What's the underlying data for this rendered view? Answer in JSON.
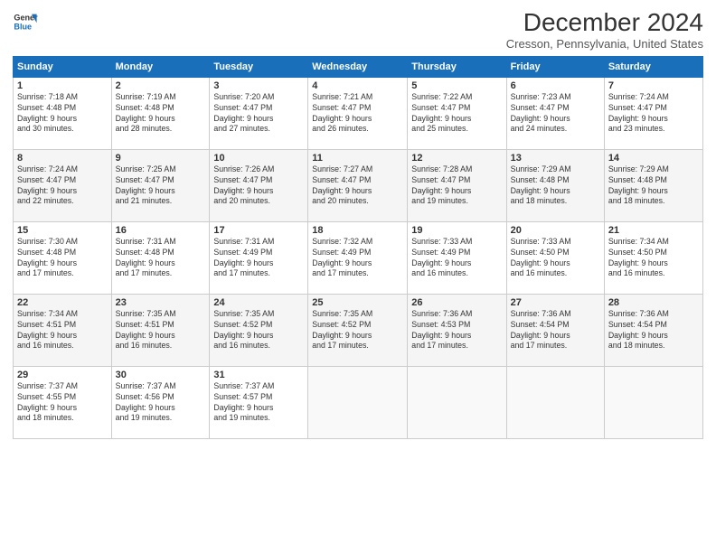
{
  "header": {
    "logo_line1": "General",
    "logo_line2": "Blue",
    "month_title": "December 2024",
    "location": "Cresson, Pennsylvania, United States"
  },
  "columns": [
    "Sunday",
    "Monday",
    "Tuesday",
    "Wednesday",
    "Thursday",
    "Friday",
    "Saturday"
  ],
  "weeks": [
    [
      {
        "day": "1",
        "info": "Sunrise: 7:18 AM\nSunset: 4:48 PM\nDaylight: 9 hours\nand 30 minutes."
      },
      {
        "day": "2",
        "info": "Sunrise: 7:19 AM\nSunset: 4:48 PM\nDaylight: 9 hours\nand 28 minutes."
      },
      {
        "day": "3",
        "info": "Sunrise: 7:20 AM\nSunset: 4:47 PM\nDaylight: 9 hours\nand 27 minutes."
      },
      {
        "day": "4",
        "info": "Sunrise: 7:21 AM\nSunset: 4:47 PM\nDaylight: 9 hours\nand 26 minutes."
      },
      {
        "day": "5",
        "info": "Sunrise: 7:22 AM\nSunset: 4:47 PM\nDaylight: 9 hours\nand 25 minutes."
      },
      {
        "day": "6",
        "info": "Sunrise: 7:23 AM\nSunset: 4:47 PM\nDaylight: 9 hours\nand 24 minutes."
      },
      {
        "day": "7",
        "info": "Sunrise: 7:24 AM\nSunset: 4:47 PM\nDaylight: 9 hours\nand 23 minutes."
      }
    ],
    [
      {
        "day": "8",
        "info": "Sunrise: 7:24 AM\nSunset: 4:47 PM\nDaylight: 9 hours\nand 22 minutes."
      },
      {
        "day": "9",
        "info": "Sunrise: 7:25 AM\nSunset: 4:47 PM\nDaylight: 9 hours\nand 21 minutes."
      },
      {
        "day": "10",
        "info": "Sunrise: 7:26 AM\nSunset: 4:47 PM\nDaylight: 9 hours\nand 20 minutes."
      },
      {
        "day": "11",
        "info": "Sunrise: 7:27 AM\nSunset: 4:47 PM\nDaylight: 9 hours\nand 20 minutes."
      },
      {
        "day": "12",
        "info": "Sunrise: 7:28 AM\nSunset: 4:47 PM\nDaylight: 9 hours\nand 19 minutes."
      },
      {
        "day": "13",
        "info": "Sunrise: 7:29 AM\nSunset: 4:48 PM\nDaylight: 9 hours\nand 18 minutes."
      },
      {
        "day": "14",
        "info": "Sunrise: 7:29 AM\nSunset: 4:48 PM\nDaylight: 9 hours\nand 18 minutes."
      }
    ],
    [
      {
        "day": "15",
        "info": "Sunrise: 7:30 AM\nSunset: 4:48 PM\nDaylight: 9 hours\nand 17 minutes."
      },
      {
        "day": "16",
        "info": "Sunrise: 7:31 AM\nSunset: 4:48 PM\nDaylight: 9 hours\nand 17 minutes."
      },
      {
        "day": "17",
        "info": "Sunrise: 7:31 AM\nSunset: 4:49 PM\nDaylight: 9 hours\nand 17 minutes."
      },
      {
        "day": "18",
        "info": "Sunrise: 7:32 AM\nSunset: 4:49 PM\nDaylight: 9 hours\nand 17 minutes."
      },
      {
        "day": "19",
        "info": "Sunrise: 7:33 AM\nSunset: 4:49 PM\nDaylight: 9 hours\nand 16 minutes."
      },
      {
        "day": "20",
        "info": "Sunrise: 7:33 AM\nSunset: 4:50 PM\nDaylight: 9 hours\nand 16 minutes."
      },
      {
        "day": "21",
        "info": "Sunrise: 7:34 AM\nSunset: 4:50 PM\nDaylight: 9 hours\nand 16 minutes."
      }
    ],
    [
      {
        "day": "22",
        "info": "Sunrise: 7:34 AM\nSunset: 4:51 PM\nDaylight: 9 hours\nand 16 minutes."
      },
      {
        "day": "23",
        "info": "Sunrise: 7:35 AM\nSunset: 4:51 PM\nDaylight: 9 hours\nand 16 minutes."
      },
      {
        "day": "24",
        "info": "Sunrise: 7:35 AM\nSunset: 4:52 PM\nDaylight: 9 hours\nand 16 minutes."
      },
      {
        "day": "25",
        "info": "Sunrise: 7:35 AM\nSunset: 4:52 PM\nDaylight: 9 hours\nand 17 minutes."
      },
      {
        "day": "26",
        "info": "Sunrise: 7:36 AM\nSunset: 4:53 PM\nDaylight: 9 hours\nand 17 minutes."
      },
      {
        "day": "27",
        "info": "Sunrise: 7:36 AM\nSunset: 4:54 PM\nDaylight: 9 hours\nand 17 minutes."
      },
      {
        "day": "28",
        "info": "Sunrise: 7:36 AM\nSunset: 4:54 PM\nDaylight: 9 hours\nand 18 minutes."
      }
    ],
    [
      {
        "day": "29",
        "info": "Sunrise: 7:37 AM\nSunset: 4:55 PM\nDaylight: 9 hours\nand 18 minutes."
      },
      {
        "day": "30",
        "info": "Sunrise: 7:37 AM\nSunset: 4:56 PM\nDaylight: 9 hours\nand 19 minutes."
      },
      {
        "day": "31",
        "info": "Sunrise: 7:37 AM\nSunset: 4:57 PM\nDaylight: 9 hours\nand 19 minutes."
      },
      {
        "day": "",
        "info": ""
      },
      {
        "day": "",
        "info": ""
      },
      {
        "day": "",
        "info": ""
      },
      {
        "day": "",
        "info": ""
      }
    ]
  ]
}
